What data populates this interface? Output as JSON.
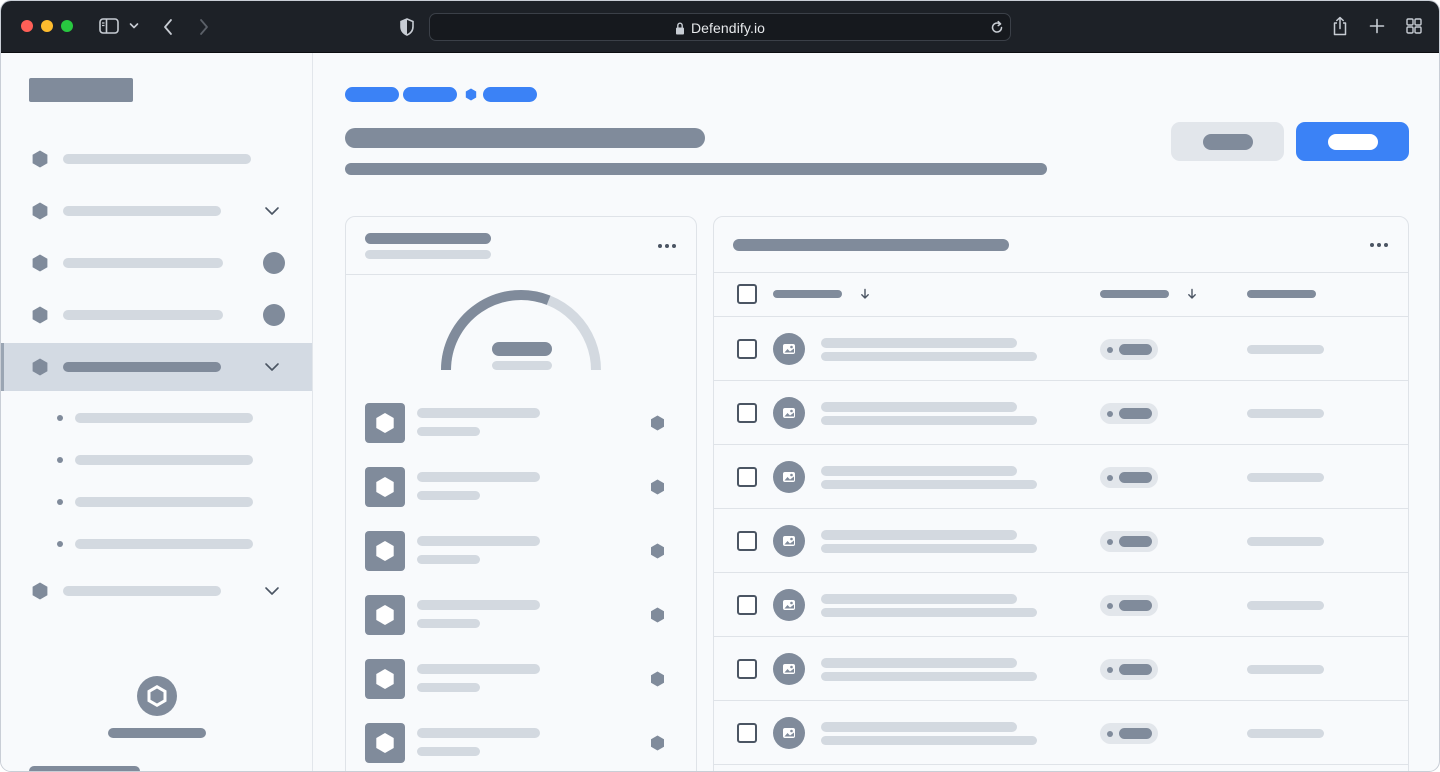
{
  "browser": {
    "url": "Defendify.io",
    "icons": [
      "sidebar-toggle-icon",
      "chevron-down-icon",
      "back-icon",
      "forward-icon",
      "shield-icon",
      "lock-icon",
      "reload-icon",
      "share-icon",
      "new-tab-icon",
      "tab-overview-icon"
    ]
  },
  "colors": {
    "accent": "#3b82f6",
    "placeholder_dark": "#808b9b",
    "placeholder_light": "#d3d9e0",
    "active_nav_bg": "#d3dae3",
    "chrome_bg": "#1d2127"
  },
  "sidebar": {
    "items": [
      {
        "label": "",
        "icon": "hexagon-icon",
        "trailing": "none"
      },
      {
        "label": "",
        "icon": "hexagon-icon",
        "trailing": "chevron-down-icon"
      },
      {
        "label": "",
        "icon": "hexagon-icon",
        "trailing": "badge"
      },
      {
        "label": "",
        "icon": "hexagon-icon",
        "trailing": "badge"
      },
      {
        "label": "",
        "icon": "hexagon-icon",
        "trailing": "chevron-down-icon",
        "active": true,
        "children": [
          "",
          "",
          "",
          ""
        ]
      },
      {
        "label": "",
        "icon": "hexagon-icon",
        "trailing": "chevron-down-icon"
      }
    ],
    "footer": {
      "icon": "hexagon-icon"
    }
  },
  "breadcrumb": {
    "items": [
      "",
      "",
      ""
    ],
    "separator_icon": "hexagon-icon"
  },
  "header": {
    "title": "",
    "subtitle": "",
    "secondary_button": "",
    "primary_button": ""
  },
  "left_card": {
    "title": "",
    "subtitle": "",
    "gauge_value": 0.62,
    "menu_icon": "more-icon",
    "list": [
      {
        "title": "",
        "meta": "",
        "icon": "hexagon-icon"
      },
      {
        "title": "",
        "meta": "",
        "icon": "hexagon-icon"
      },
      {
        "title": "",
        "meta": "",
        "icon": "hexagon-icon"
      },
      {
        "title": "",
        "meta": "",
        "icon": "hexagon-icon"
      },
      {
        "title": "",
        "meta": "",
        "icon": "hexagon-icon"
      },
      {
        "title": "",
        "meta": "",
        "icon": "hexagon-icon"
      }
    ]
  },
  "right_card": {
    "title": "",
    "menu_icon": "more-icon",
    "columns": [
      "",
      "",
      ""
    ],
    "sort_icons": [
      "arrow-down-icon",
      "arrow-down-icon"
    ],
    "rows": [
      {
        "name": "",
        "detail": "",
        "status": "",
        "value": "",
        "avatar": "image-icon"
      },
      {
        "name": "",
        "detail": "",
        "status": "",
        "value": "",
        "avatar": "image-icon"
      },
      {
        "name": "",
        "detail": "",
        "status": "",
        "value": "",
        "avatar": "image-icon"
      },
      {
        "name": "",
        "detail": "",
        "status": "",
        "value": "",
        "avatar": "image-icon"
      },
      {
        "name": "",
        "detail": "",
        "status": "",
        "value": "",
        "avatar": "image-icon"
      },
      {
        "name": "",
        "detail": "",
        "status": "",
        "value": "",
        "avatar": "image-icon"
      },
      {
        "name": "",
        "detail": "",
        "status": "",
        "value": "",
        "avatar": "image-icon"
      }
    ]
  }
}
